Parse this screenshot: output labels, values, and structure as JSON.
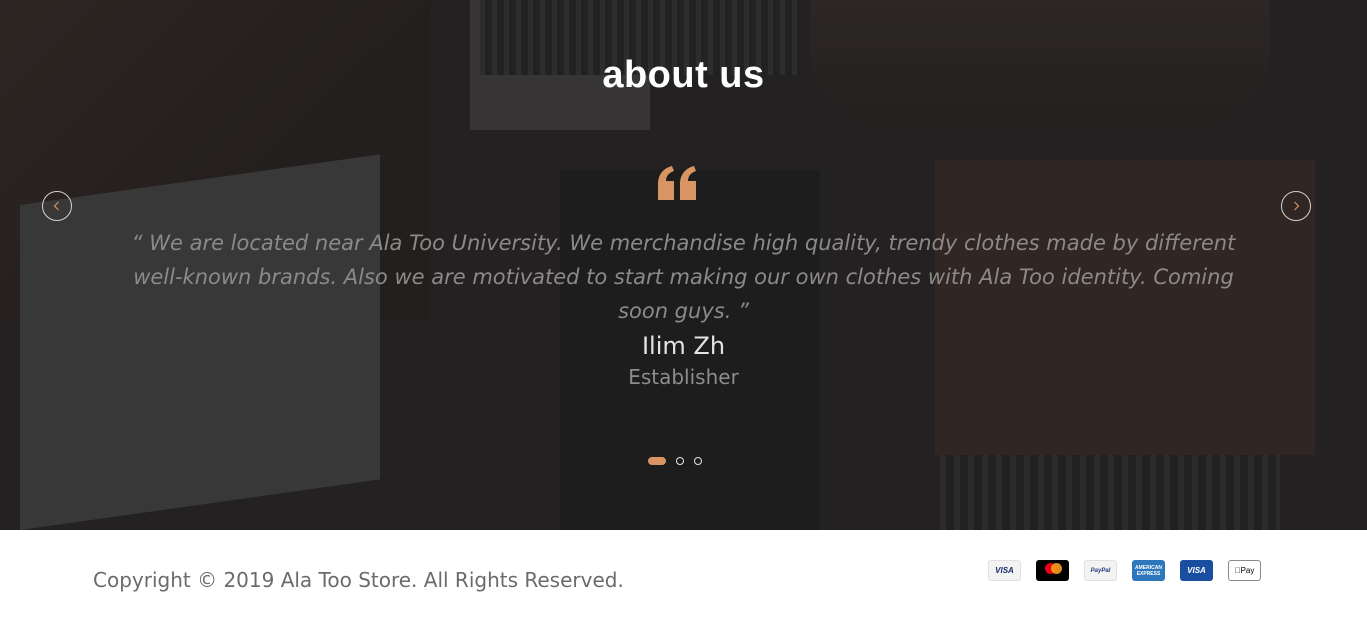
{
  "about": {
    "title": "about us",
    "quote": "“ We are located near Ala Too University. We merchandise high quality, trendy clothes made by different well-known brands. Also we are motivated to start making our own clothes with Ala Too identity. Coming soon guys. ”",
    "author_name": "Ilim Zh",
    "author_role": "Establisher",
    "slides_total": 3,
    "active_slide": 1,
    "prev_icon": "chevron-left-icon",
    "next_icon": "chevron-right-icon"
  },
  "footer": {
    "copyright": "Copyright © 2019 Ala Too Store. All Rights Reserved.",
    "payment_methods": [
      {
        "name": "visa",
        "label": "VISA"
      },
      {
        "name": "mastercard",
        "label": ""
      },
      {
        "name": "paypal",
        "label": "PayPal"
      },
      {
        "name": "american-express",
        "label": "AMERICAN EXPRESS"
      },
      {
        "name": "visa-electron",
        "label": "VISA"
      },
      {
        "name": "apple-pay",
        "label": "Pay"
      }
    ]
  },
  "colors": {
    "accent": "#d89462",
    "overlay": "#2b2828",
    "footer_bg": "#ffffff"
  }
}
